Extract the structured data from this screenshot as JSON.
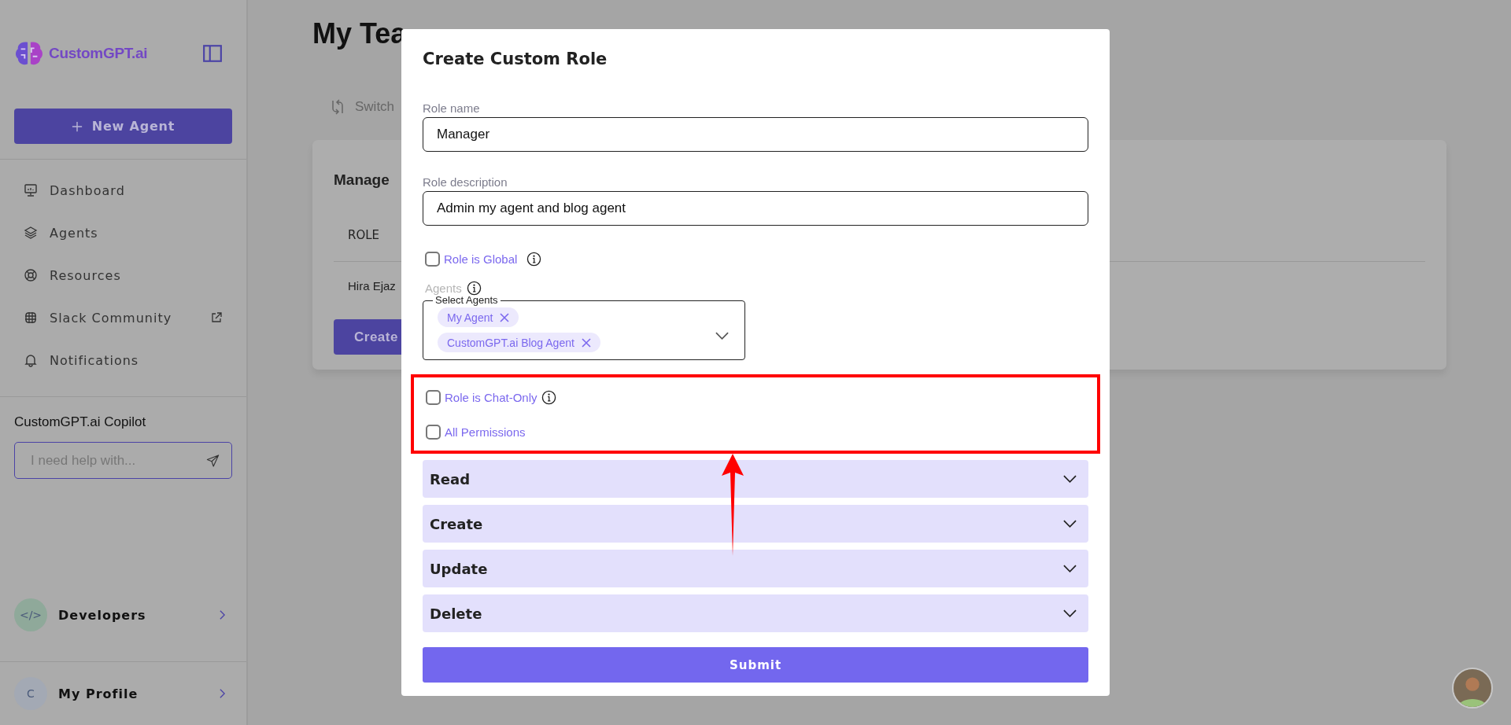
{
  "sidebar": {
    "logo": "CustomGPT.ai",
    "new_agent_button": "New Agent",
    "nav_items": [
      {
        "label": "Dashboard",
        "external": false
      },
      {
        "label": "Agents",
        "external": false
      },
      {
        "label": "Resources",
        "external": false
      },
      {
        "label": "Slack Community",
        "external": true
      },
      {
        "label": "Notifications",
        "external": false
      }
    ],
    "copilot": {
      "title": "CustomGPT.ai Copilot",
      "placeholder": "I need help with..."
    },
    "footer_items": [
      {
        "label": "Developers",
        "badge": "</>",
        "color": "#8fa99a"
      },
      {
        "label": "My Profile",
        "badge": "C",
        "color": "#a3a9b4"
      }
    ]
  },
  "page": {
    "title": "My Tea",
    "switch_label": "Switch",
    "card": {
      "title": "Manage",
      "column_1": "ROLE",
      "row_1": "Hira Ejaz",
      "button": "Create"
    }
  },
  "modal": {
    "title": "Create Custom Role",
    "fields": [
      {
        "label": "Role name",
        "value": "Manager"
      },
      {
        "label": "Role description",
        "value": "Admin my agent and blog agent"
      }
    ],
    "global_checkbox": {
      "label": "Role is Global",
      "checked": false
    },
    "agents": {
      "label": "Agents",
      "legend": "Select Agents",
      "chips": [
        "My Agent",
        "CustomGPT.ai Blog Agent"
      ]
    },
    "options": [
      {
        "label": "Role is Chat-Only",
        "checked": false,
        "info": true
      },
      {
        "label": "All Permissions",
        "checked": false,
        "info": false
      }
    ],
    "sections": [
      {
        "label": "Read",
        "expanded": false
      },
      {
        "label": "Create",
        "expanded": false
      },
      {
        "label": "Update",
        "expanded": false
      },
      {
        "label": "Delete",
        "expanded": false
      }
    ],
    "submit": "Submit"
  }
}
